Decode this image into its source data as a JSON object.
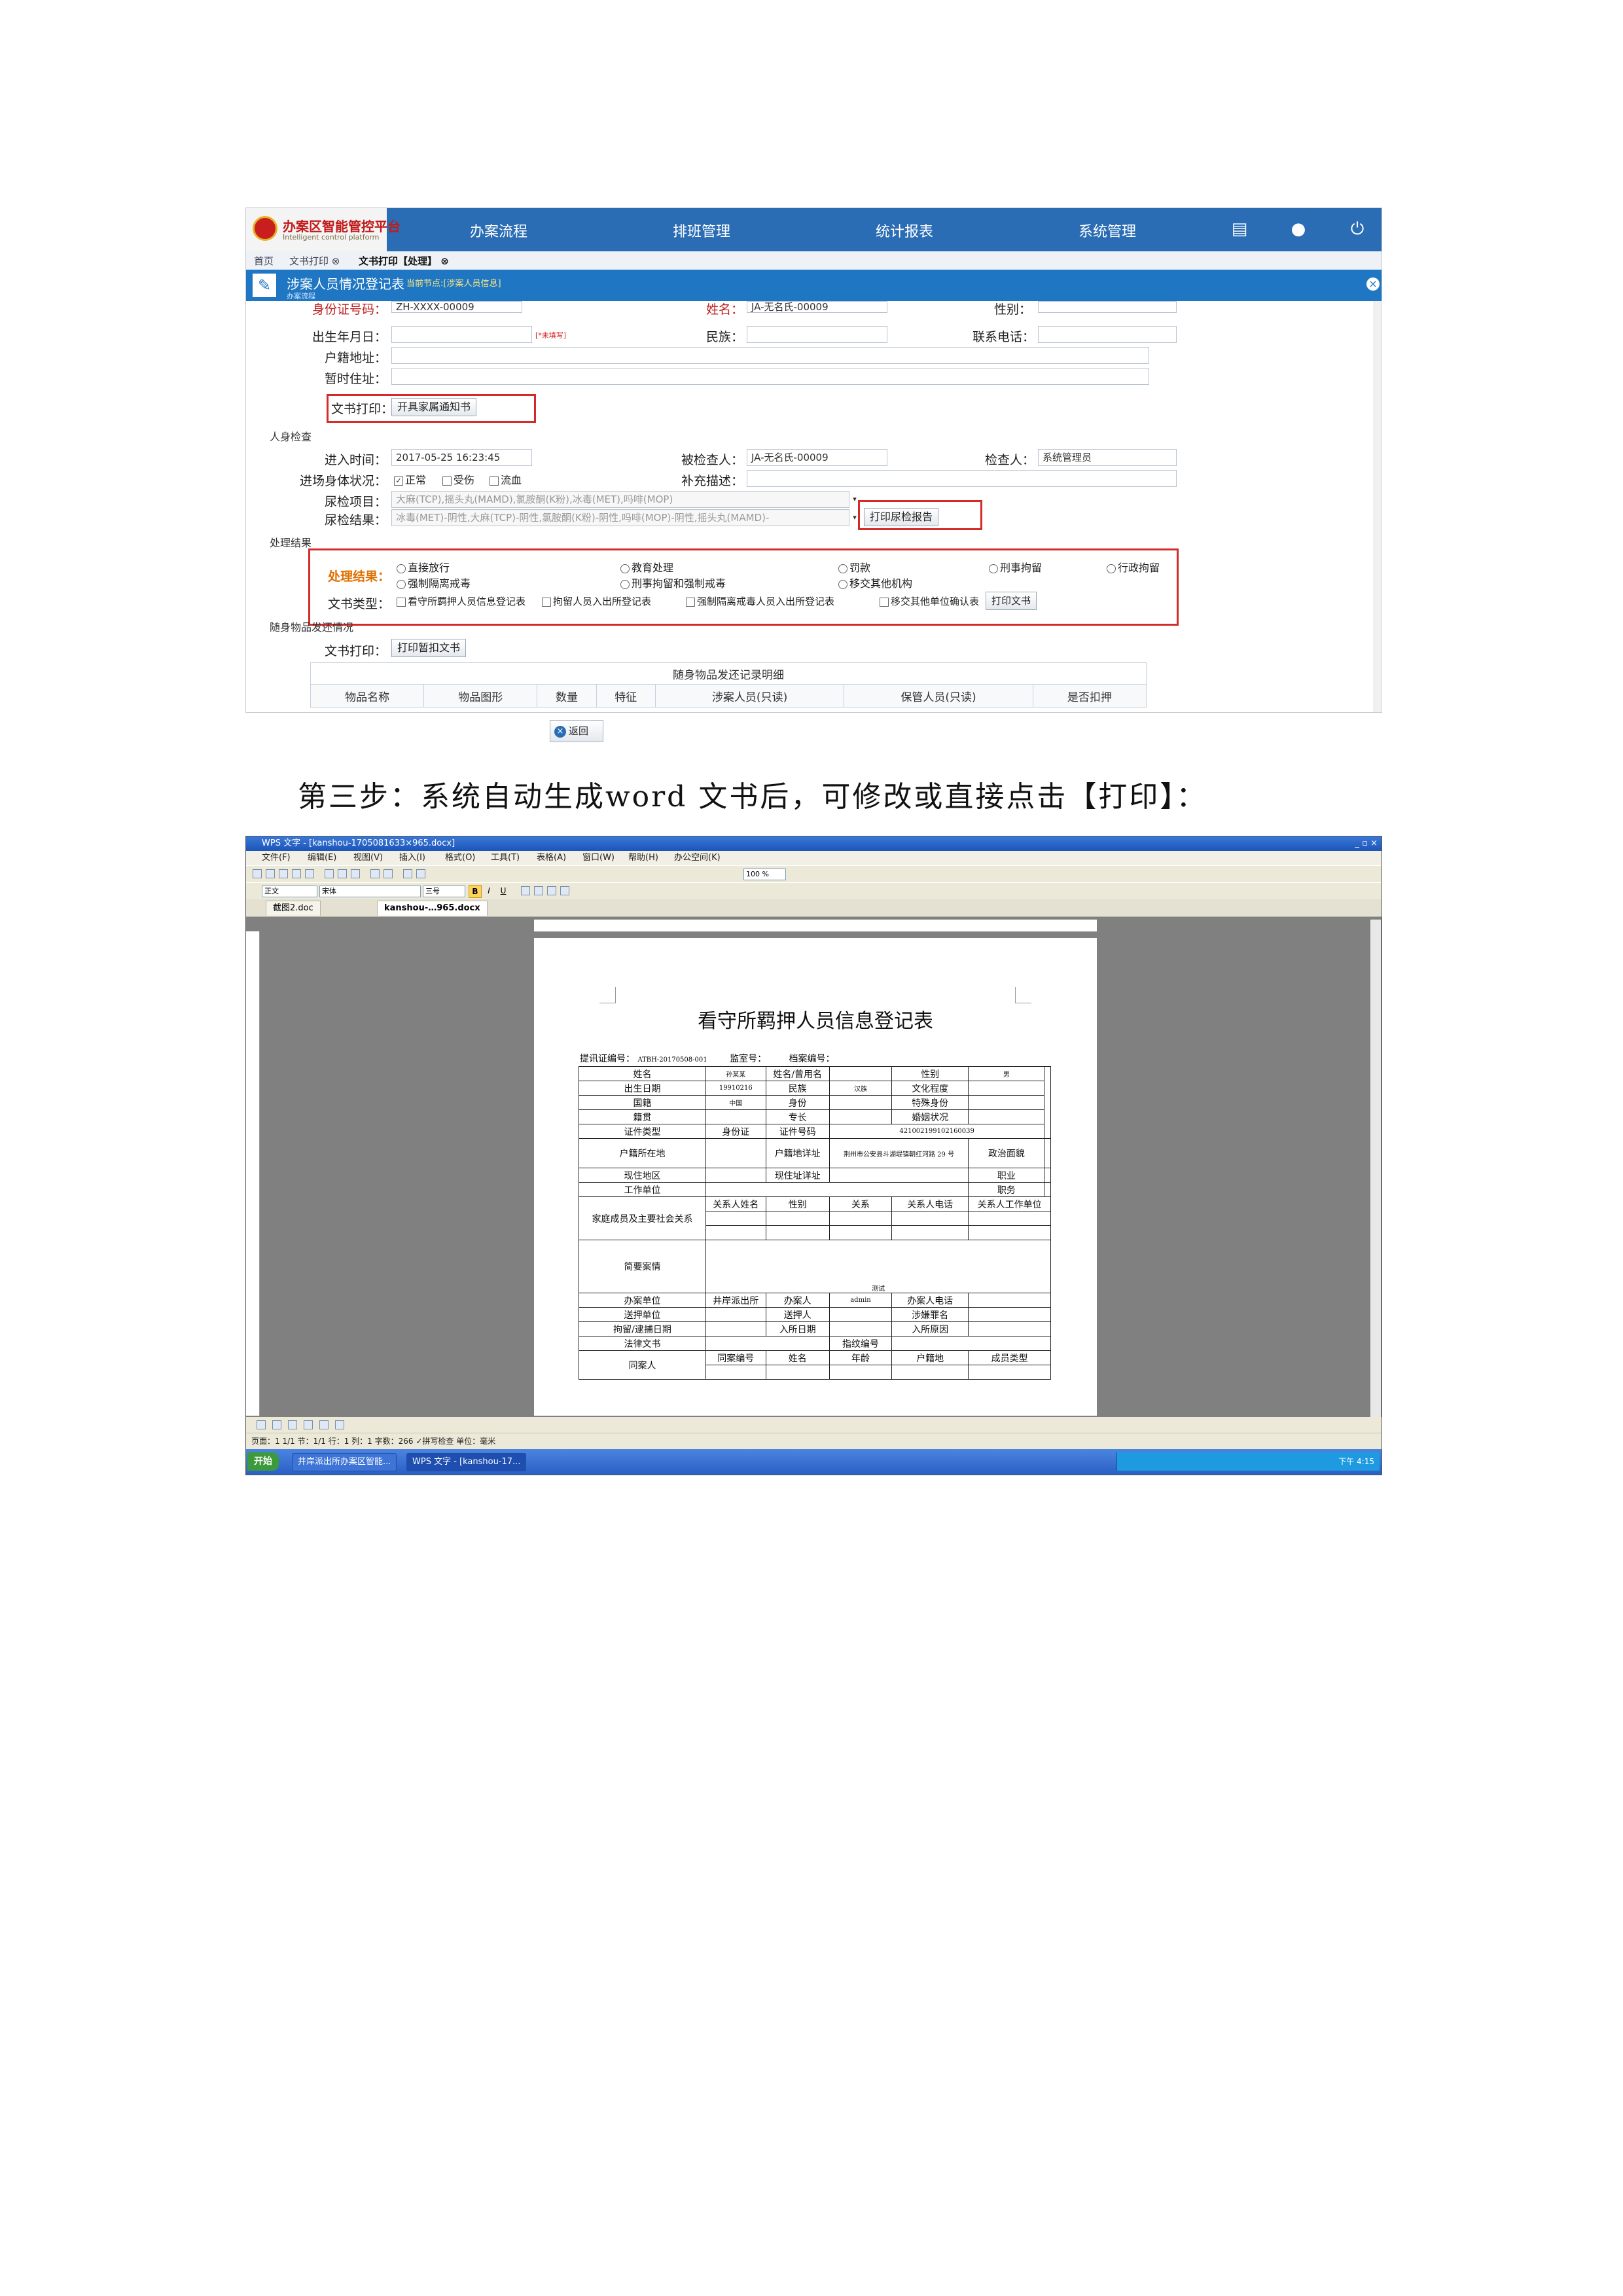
{
  "app": {
    "logo_title": "办案区智能管控平台",
    "logo_subtitle": "Intelligent control platform",
    "nav": [
      "办案流程",
      "排班管理",
      "统计报表",
      "系统管理"
    ],
    "nav_icons": [
      "list-icon",
      "user-icon",
      "power-icon"
    ]
  },
  "tabs": [
    {
      "label": "首页"
    },
    {
      "label": "文书打印 ⊗"
    },
    {
      "label": "文书打印【处理】 ⊗"
    }
  ],
  "panel": {
    "title": "涉案人员情况登记表",
    "current_node": "当前节点:[涉案人员信息]",
    "subtitle": "办案流程"
  },
  "form": {
    "row0": {
      "id_label": "身份证号码：",
      "id_value": "ZH-XXXX-00009",
      "name_label": "姓名：",
      "name_value": "JA-无名氏-00009",
      "gender_label": "性别："
    },
    "birth_label": "出生年月日：",
    "birth_hint": "[*未填写]",
    "ethnic_label": "民族：",
    "phone_label": "联系电话：",
    "household_label": "户籍地址：",
    "temp_label": "暂时住址：",
    "doc_print_label": "文书打印：",
    "doc_print_btn": "开具家属通知书",
    "section_body": "人身检查",
    "entry_time_label": "进入时间：",
    "entry_time_value": "2017-05-25 16:23:45",
    "examinee_label": "被检查人：",
    "examinee_value": "JA-无名氏-00009",
    "inspector_label": "检查人：",
    "inspector_value": "系统管理员",
    "condition_label": "进场身体状况：",
    "condition_options": [
      "正常",
      "受伤",
      "流血"
    ],
    "extra_label": "补充描述：",
    "urine_items_label": "尿检项目：",
    "urine_items_value": "大麻(TCP),摇头丸(MAMD),氯胺酮(K粉),冰毒(MET),吗啡(MOP)",
    "urine_result_label": "尿检结果：",
    "urine_result_value": "冰毒(MET)-阴性,大麻(TCP)-阴性,氯胺酮(K粉)-阴性,吗啡(MOP)-阴性,摇头丸(MAMD)-",
    "urine_report_btn": "打印尿检报告",
    "section_result": "处理结果",
    "result_label": "处理结果：",
    "result_options_row1": [
      "直接放行",
      "教育处理",
      "罚款",
      "刑事拘留",
      "行政拘留"
    ],
    "result_options_row2": [
      "强制隔离戒毒",
      "刑事拘留和强制戒毒",
      "移交其他机构"
    ],
    "doctype_label": "文书类型：",
    "doctype_options": [
      "看守所羁押人员信息登记表",
      "拘留人员入出所登记表",
      "强制隔离戒毒人员入出所登记表",
      "移交其他单位确认表"
    ],
    "doctype_btn": "打印文书",
    "section_items": "随身物品发还情况",
    "items_print_label": "文书打印：",
    "items_print_btn": "打印暂扣文书",
    "items_caption": "随身物品发还记录明细",
    "items_columns": [
      "物品名称",
      "物品图形",
      "数量",
      "特征",
      "涉案人员(只读)",
      "保管人员(只读)",
      "是否扣押"
    ],
    "back_btn": "返回"
  },
  "caption": "第三步：系统自动生成word 文书后，可修改或直接点击【打印】：",
  "wps": {
    "window_title": "WPS 文字 - [kanshou-1705081633×965.docx]",
    "menu": [
      "文件(F)",
      "编辑(E)",
      "视图(V)",
      "插入(I)",
      "格式(O)",
      "工具(T)",
      "表格(A)",
      "窗口(W)",
      "帮助(H)",
      "办公空间(K)"
    ],
    "style_value": "正文",
    "font_value": "宋体",
    "size_value": "三号",
    "zoom_value": "100 %",
    "doc_tab1": "截图2.doc",
    "doc_tab2": "kanshou-…965.docx",
    "doc_title": "看守所羁押人员信息登记表",
    "header_line": {
      "label1": "提讯证编号：",
      "value1": "ATBH-20170508-001",
      "label2": "监室号：",
      "label3": "档案编号："
    },
    "rows": {
      "name_label": "姓名",
      "name_value": "孙某某",
      "alias_label": "姓名/曾用名",
      "gender_label": "性别",
      "gender_value": "男",
      "birth_label": "出生日期",
      "birth_value": "19910216",
      "ethnic_label": "民族",
      "ethnic_value": "汉族",
      "edu_label": "文化程度",
      "nation_label": "国籍",
      "nation_value": "中国",
      "identity_label": "身份",
      "special_label": "特殊身份",
      "native_label": "籍贯",
      "skill_label": "专长",
      "marital_label": "婚姻状况",
      "idtype_label": "证件类型",
      "idtype_value": "身份证",
      "idno_label": "证件号码",
      "idno_value": "421002199102160039",
      "reg_label": "户籍所在地",
      "reg_detail_label": "户籍地详址",
      "reg_detail_value": "荆州市公安县斗湖堤镇朝红河路 29 号",
      "political_label": "政治面貌",
      "live_label": "现住地区",
      "live_detail_label": "现住址详址",
      "job_label": "职业",
      "work_label": "工作单位",
      "duty_label": "职务",
      "family_label": "家庭成员及主要社会关系",
      "fam_cols": [
        "关系人姓名",
        "性别",
        "关系",
        "关系人电话",
        "关系人工作单位"
      ],
      "brief_label": "简要案情",
      "brief_value": "测试",
      "unit_label": "办案单位",
      "unit_value": "井岸派出所",
      "handler_label": "办案人",
      "handler_value": "admin",
      "handler_phone_label": "办案人电话",
      "escort_unit_label": "送押单位",
      "escort_label": "送押人",
      "crime_label": "涉嫌罪名",
      "detain_date_label": "拘留/逮捕日期",
      "enter_date_label": "入所日期",
      "enter_reason_label": "入所原因",
      "legal_doc_label": "法律文书",
      "finger_label": "指纹编号",
      "accomp_label": "同案人",
      "acc_cols": [
        "同案编号",
        "姓名",
        "年龄",
        "户籍地",
        "成员类型"
      ]
    },
    "status": "页面：1  1/1  节：1/1  行：1  列：1  字数：266  ✓拼写检查  单位：毫米",
    "start": "开始",
    "tasks": [
      "井岸派出所办案区智能...",
      "WPS 文字 - [kanshou-17..."
    ],
    "clock": "下午 4:15"
  }
}
